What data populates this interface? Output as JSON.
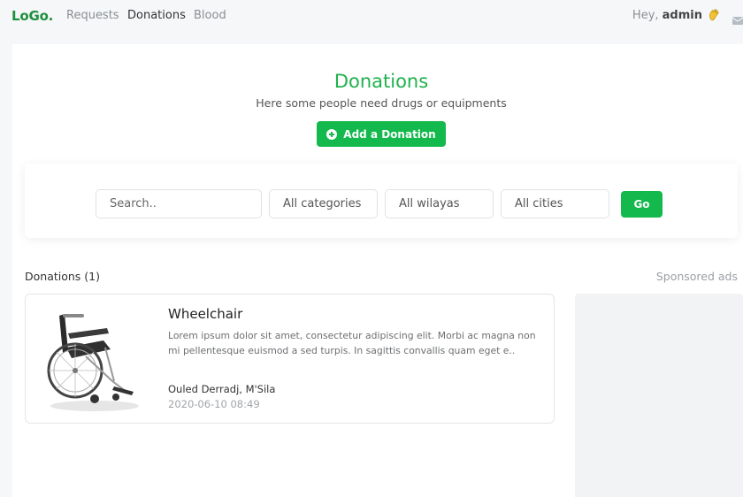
{
  "nav": {
    "logo": "LoGo.",
    "links": [
      "Requests",
      "Donations",
      "Blood"
    ],
    "active_link": "Donations",
    "greeting_prefix": "Hey, ",
    "username": "admin"
  },
  "hero": {
    "title": "Donations",
    "subtitle": "Here some people need drugs or equipments",
    "add_button_label": "Add a Donation"
  },
  "filters": {
    "search_placeholder": "Search..",
    "category": "All categories",
    "wilaya": "All wilayas",
    "city": "All cities",
    "go_label": "Go"
  },
  "list": {
    "header": "Donations (1)",
    "ads_label": "Sponsored ads",
    "items": [
      {
        "title": "Wheelchair",
        "description": "Lorem ipsum dolor sit amet, consectetur adipiscing elit. Morbi ac magna non mi pellentesque euismod a sed turpis. In sagittis convallis quam eget e..",
        "location": "Ouled Derradj, M'Sila",
        "date": "2020-06-10 08:49",
        "image_icon": "wheelchair-image"
      }
    ]
  },
  "colors": {
    "brand_green": "#13b94c",
    "title_green": "#1fb24d",
    "logo_green": "#1e8f3e"
  }
}
